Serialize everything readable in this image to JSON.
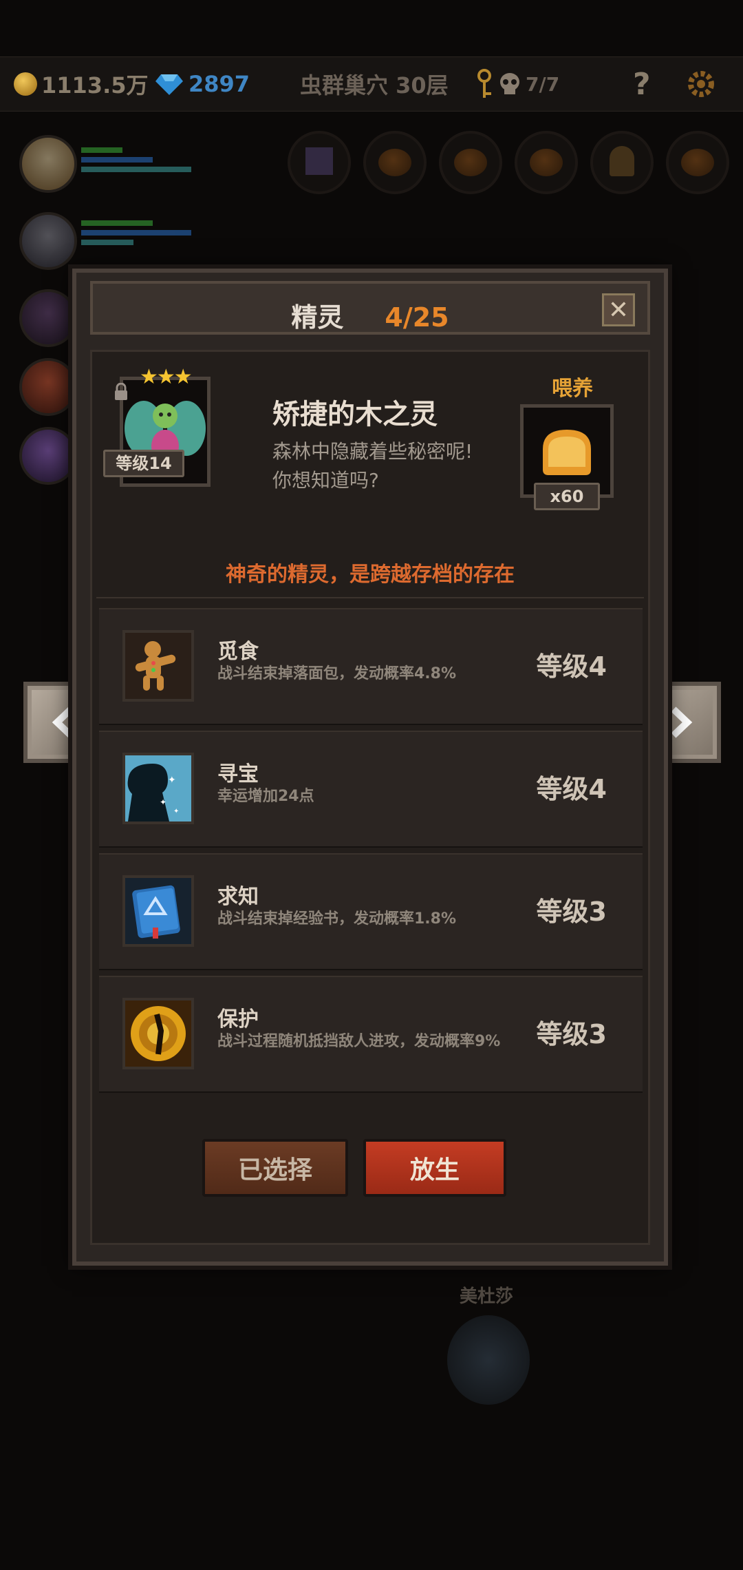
{
  "topbar": {
    "coins": "1113.5万",
    "gems": "2897",
    "floor": "虫群巢穴 30层",
    "keys": "7/7",
    "help": "?"
  },
  "background": {
    "unit_name": "美杜莎"
  },
  "modal": {
    "title": "精灵",
    "count": "4/25",
    "close": "✕"
  },
  "spirit": {
    "stars": "★★★",
    "level": "等级14",
    "name": "矫捷的木之灵",
    "description_line1": "森林中隐藏着些秘密呢!",
    "description_line2": "你想知道吗?",
    "feed_label": "喂养",
    "feed_count": "x60",
    "tagline": "神奇的精灵，是跨越存档的存在"
  },
  "skills": [
    {
      "name": "觅食",
      "description": "战斗结束掉落面包，发动概率4.8%",
      "level": "等级4",
      "icon": "gingerbread-icon"
    },
    {
      "name": "寻宝",
      "description": "幸运增加24点",
      "level": "等级4",
      "icon": "silhouette-sparkle-icon"
    },
    {
      "name": "求知",
      "description": "战斗结束掉经验书，发动概率1.8%",
      "level": "等级3",
      "icon": "book-icon"
    },
    {
      "name": "保护",
      "description": "战斗过程随机抵挡敌人进攻，发动概率9%",
      "level": "等级3",
      "icon": "shield-spiral-icon"
    }
  ],
  "buttons": {
    "selected": "已选择",
    "release": "放生"
  },
  "colors": {
    "accent_orange": "#e8872a",
    "tagline_red": "#dd6a2f",
    "release_red": "#c43c23",
    "star_gold": "#f5c431"
  }
}
